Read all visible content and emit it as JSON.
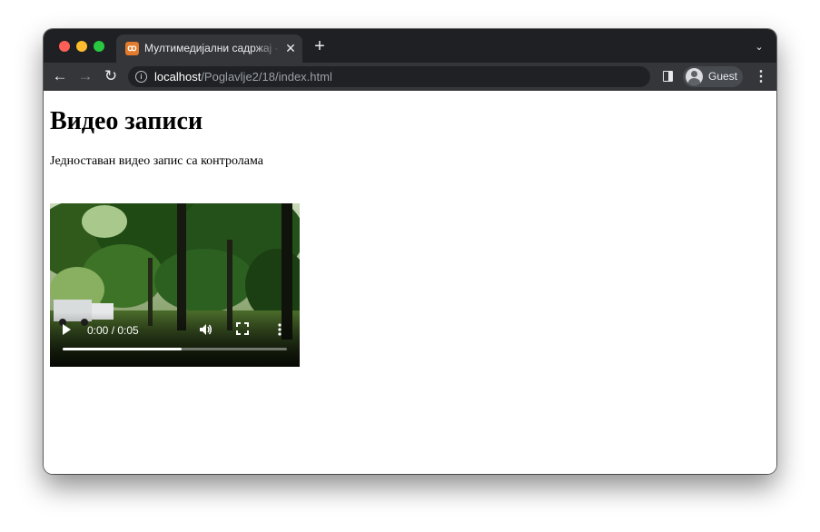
{
  "browser": {
    "tab": {
      "title": "Мултимедијални садржај - видео записи",
      "close_icon": "close-icon",
      "favicon_icon": "xampp-favicon-icon"
    },
    "new_tab_icon": "plus-icon",
    "tab_search_icon": "chevron-down-icon",
    "nav": {
      "back_icon": "arrow-left-icon",
      "forward_icon": "arrow-right-icon",
      "reload_icon": "reload-icon"
    },
    "address": {
      "host": "localhost",
      "path": "/Poglavlje2/18/index.html",
      "info_icon": "info-icon"
    },
    "profile": {
      "label": "Guest",
      "icon": "avatar-icon"
    },
    "side_panel_icon": "side-panel-icon",
    "menu_icon": "kebab-menu-icon"
  },
  "page": {
    "heading": "Видео записи",
    "description": "Једноставан видео запис са контролама",
    "video": {
      "time": "0:00 / 0:05",
      "buffered_fraction": 0.53,
      "play_icon": "play-icon",
      "volume_icon": "volume-icon",
      "fullscreen_icon": "fullscreen-icon",
      "more_icon": "more-vert-icon"
    }
  },
  "colors": {
    "tabstrip": "#1f2023",
    "toolbar": "#35363a",
    "omnibox": "#202124",
    "traffic_red": "#fe5f57",
    "traffic_yellow": "#febc2e",
    "traffic_green": "#28c840"
  }
}
